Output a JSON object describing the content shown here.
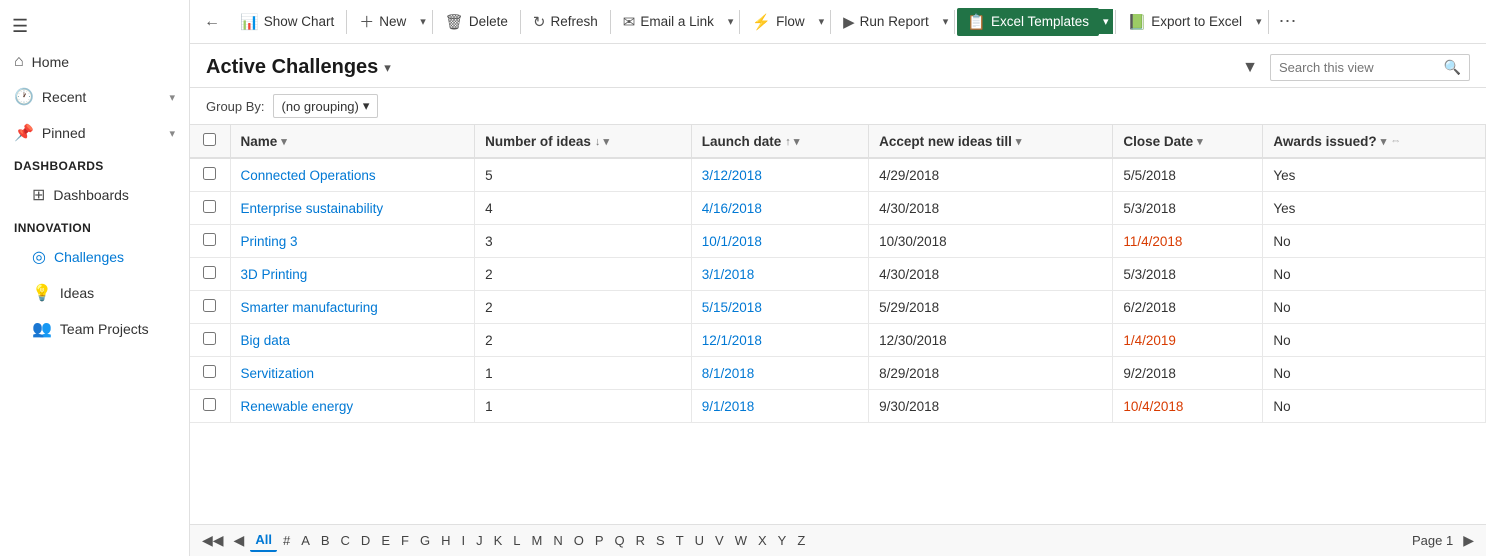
{
  "sidebar": {
    "hamburger": "≡",
    "nav": [
      {
        "id": "home",
        "icon": "⌂",
        "label": "Home",
        "chevron": false,
        "sub": false
      },
      {
        "id": "recent",
        "icon": "🕐",
        "label": "Recent",
        "chevron": true,
        "sub": false
      },
      {
        "id": "pinned",
        "icon": "📌",
        "label": "Pinned",
        "chevron": true,
        "sub": false
      }
    ],
    "sections": [
      {
        "header": "Dashboards",
        "items": [
          {
            "id": "dashboards",
            "icon": "⊞",
            "label": "Dashboards",
            "sub": true
          }
        ]
      },
      {
        "header": "Innovation",
        "items": [
          {
            "id": "challenges",
            "icon": "◎",
            "label": "Challenges",
            "sub": true,
            "active": true
          },
          {
            "id": "ideas",
            "icon": "💡",
            "label": "Ideas",
            "sub": true
          },
          {
            "id": "team-projects",
            "icon": "👥",
            "label": "Team Projects",
            "sub": true
          }
        ]
      }
    ]
  },
  "toolbar": {
    "back_icon": "←",
    "show_chart_label": "Show Chart",
    "new_label": "New",
    "delete_label": "Delete",
    "refresh_label": "Refresh",
    "email_link_label": "Email a Link",
    "flow_label": "Flow",
    "run_report_label": "Run Report",
    "excel_templates_label": "Excel Templates",
    "export_to_excel_label": "Export to Excel",
    "more_icon": "⋯"
  },
  "page_header": {
    "title": "Active Challenges",
    "search_placeholder": "Search this view"
  },
  "groupby": {
    "label": "Group By:",
    "value": "(no grouping)"
  },
  "table": {
    "columns": [
      {
        "id": "check",
        "label": ""
      },
      {
        "id": "name",
        "label": "Name",
        "sort": "asc"
      },
      {
        "id": "num_ideas",
        "label": "Number of ideas",
        "sort": "desc"
      },
      {
        "id": "launch_date",
        "label": "Launch date",
        "sort": "asc"
      },
      {
        "id": "accept_new",
        "label": "Accept new ideas till",
        "sort": "none"
      },
      {
        "id": "close_date",
        "label": "Close Date",
        "sort": "none"
      },
      {
        "id": "awards",
        "label": "Awards issued?",
        "sort": "none"
      }
    ],
    "rows": [
      {
        "name": "Connected Operations",
        "num_ideas": "5",
        "launch_date": "3/12/2018",
        "accept_new": "4/29/2018",
        "close_date": "5/5/2018",
        "close_overdue": false,
        "awards": "Yes"
      },
      {
        "name": "Enterprise sustainability",
        "num_ideas": "4",
        "launch_date": "4/16/2018",
        "accept_new": "4/30/2018",
        "close_date": "5/3/2018",
        "close_overdue": false,
        "awards": "Yes"
      },
      {
        "name": "Printing 3",
        "num_ideas": "3",
        "launch_date": "10/1/2018",
        "accept_new": "10/30/2018",
        "close_date": "11/4/2018",
        "close_overdue": true,
        "awards": "No"
      },
      {
        "name": "3D Printing",
        "num_ideas": "2",
        "launch_date": "3/1/2018",
        "accept_new": "4/30/2018",
        "close_date": "5/3/2018",
        "close_overdue": false,
        "awards": "No"
      },
      {
        "name": "Smarter manufacturing",
        "num_ideas": "2",
        "launch_date": "5/15/2018",
        "accept_new": "5/29/2018",
        "close_date": "6/2/2018",
        "close_overdue": false,
        "awards": "No"
      },
      {
        "name": "Big data",
        "num_ideas": "2",
        "launch_date": "12/1/2018",
        "accept_new": "12/30/2018",
        "close_date": "1/4/2019",
        "close_overdue": true,
        "awards": "No"
      },
      {
        "name": "Servitization",
        "num_ideas": "1",
        "launch_date": "8/1/2018",
        "accept_new": "8/29/2018",
        "close_date": "9/2/2018",
        "close_overdue": false,
        "awards": "No"
      },
      {
        "name": "Renewable energy",
        "num_ideas": "1",
        "launch_date": "9/1/2018",
        "accept_new": "9/30/2018",
        "close_date": "10/4/2018",
        "close_overdue": true,
        "awards": "No"
      }
    ]
  },
  "bottom_nav": {
    "letters": [
      "All",
      "#",
      "A",
      "B",
      "C",
      "D",
      "E",
      "F",
      "G",
      "H",
      "I",
      "J",
      "K",
      "L",
      "M",
      "N",
      "O",
      "P",
      "Q",
      "R",
      "S",
      "T",
      "U",
      "V",
      "W",
      "X",
      "Y",
      "Z"
    ],
    "active": "All",
    "page_label": "Page 1"
  }
}
